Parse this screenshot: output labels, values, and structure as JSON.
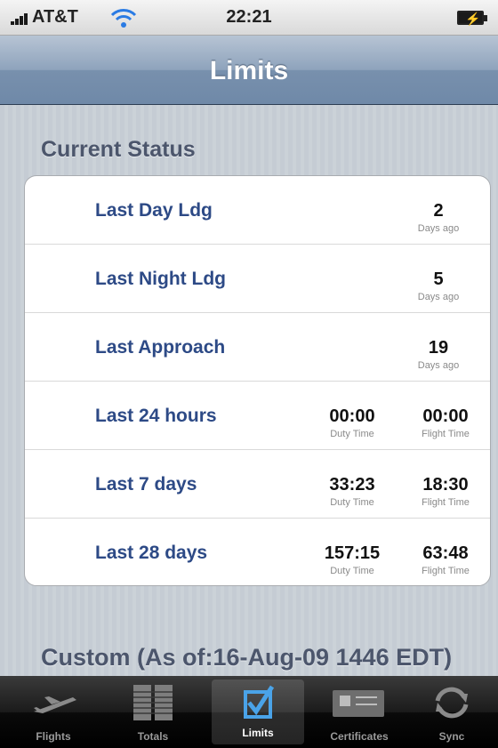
{
  "status_bar": {
    "carrier": "AT&T",
    "time": "22:21",
    "signal_icon": "signal-bars-icon",
    "wifi_icon": "wifi-icon",
    "battery_icon": "battery-charging-icon"
  },
  "nav": {
    "title": "Limits"
  },
  "sections": {
    "current": {
      "title": "Current Status"
    },
    "custom": {
      "title": "Custom (As of:16-Aug-09 1446 EDT)"
    }
  },
  "rows": [
    {
      "label": "Last Day Ldg",
      "value": "2",
      "unit": "Days ago"
    },
    {
      "label": "Last Night Ldg",
      "value": "5",
      "unit": "Days ago"
    },
    {
      "label": "Last Approach",
      "value": "19",
      "unit": "Days ago"
    },
    {
      "label": "Last 24 hours",
      "duty": "00:00",
      "duty_unit": "Duty Time",
      "flight": "00:00",
      "flight_unit": "Flight Time"
    },
    {
      "label": "Last 7 days",
      "duty": "33:23",
      "duty_unit": "Duty Time",
      "flight": "18:30",
      "flight_unit": "Flight Time"
    },
    {
      "label": "Last 28 days",
      "duty": "157:15",
      "duty_unit": "Duty Time",
      "flight": "63:48",
      "flight_unit": "Flight Time"
    }
  ],
  "tabs": [
    {
      "label": "Flights",
      "icon": "airplane-icon",
      "selected": false
    },
    {
      "label": "Totals",
      "icon": "ledger-icon",
      "selected": false
    },
    {
      "label": "Limits",
      "icon": "checkbox-icon",
      "selected": true
    },
    {
      "label": "Certificates",
      "icon": "certificate-icon",
      "selected": false
    },
    {
      "label": "Sync",
      "icon": "sync-icon",
      "selected": false
    }
  ],
  "colors": {
    "accent_label": "#2d4a86",
    "nav_bar": "#7890ad",
    "tab_selected_icon": "#4aa3e8"
  }
}
